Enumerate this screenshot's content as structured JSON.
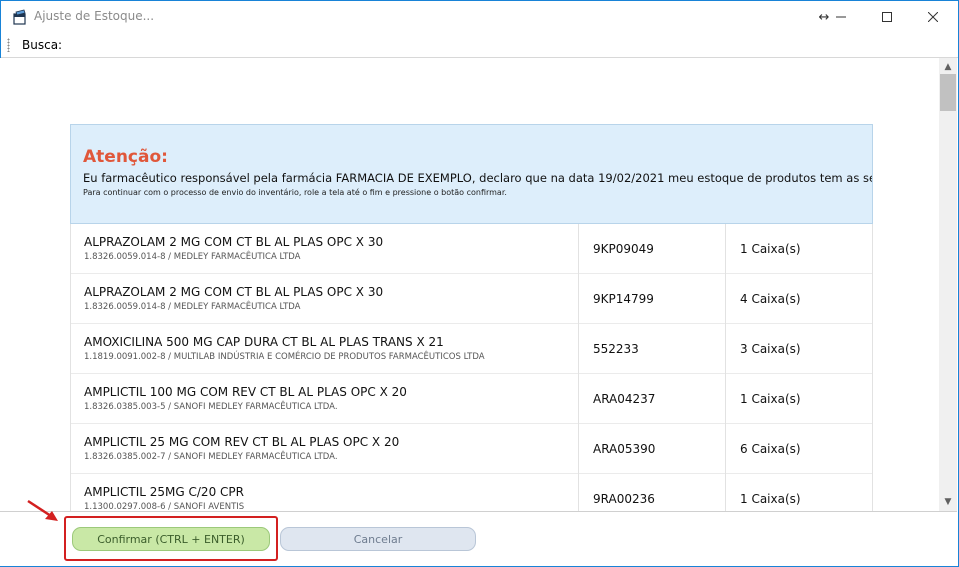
{
  "window": {
    "title": "Ajuste de Estoque...",
    "icons": {
      "app": "app-icon",
      "resize": "resize-icon",
      "minimize": "minimize-icon",
      "maximize": "maximize-icon",
      "close": "close-icon"
    }
  },
  "toolbar": {
    "search_label": "Busca:",
    "search_value": ""
  },
  "notice": {
    "title": "Atenção:",
    "declaration": "Eu farmacêutico responsável pela farmácia FARMACIA DE EXEMPLO, declaro que na data 19/02/2021 meu estoque de produtos tem as seguintes qua",
    "instruction": "Para continuar com o processo de envio do inventário, role a tela até o fim e pressione o botão confirmar.",
    "bg_color": "#ddeefb",
    "title_color": "#e0573a"
  },
  "products": [
    {
      "name": "ALPRAZOLAM 2 MG COM CT BL AL PLAS OPC X 30",
      "detail": "1.8326.0059.014-8 / MEDLEY FARMACÊUTICA LTDA",
      "lot": "9KP09049",
      "qty": "1 Caixa(s)"
    },
    {
      "name": "ALPRAZOLAM 2 MG COM CT BL AL PLAS OPC X 30",
      "detail": "1.8326.0059.014-8 / MEDLEY FARMACÊUTICA LTDA",
      "lot": "9KP14799",
      "qty": "4 Caixa(s)"
    },
    {
      "name": "AMOXICILINA 500 MG CAP DURA CT BL AL PLAS TRANS X 21",
      "detail": "1.1819.0091.002-8 / MULTILAB INDÚSTRIA E COMÉRCIO DE PRODUTOS FARMACÊUTICOS LTDA",
      "lot": "552233",
      "qty": "3 Caixa(s)"
    },
    {
      "name": "AMPLICTIL 100 MG COM REV CT BL AL PLAS OPC X 20",
      "detail": "1.8326.0385.003-5 / SANOFI MEDLEY FARMACÊUTICA LTDA.",
      "lot": "ARA04237",
      "qty": "1 Caixa(s)"
    },
    {
      "name": "AMPLICTIL 25 MG COM REV CT BL AL PLAS OPC X 20",
      "detail": "1.8326.0385.002-7 / SANOFI MEDLEY FARMACÊUTICA LTDA.",
      "lot": "ARA05390",
      "qty": "6 Caixa(s)"
    },
    {
      "name": "AMPLICTIL 25MG C/20 CPR",
      "detail": "1.1300.0297.008-6 / SANOFI AVENTIS",
      "lot": "9RA00236",
      "qty": "1 Caixa(s)"
    }
  ],
  "footer": {
    "confirm_label": "Confirmar (CTRL + ENTER)",
    "cancel_label": "Cancelar",
    "confirm_color": "#c9e8a6",
    "cancel_color": "#dfe6f0",
    "highlight_color": "#d32020"
  }
}
